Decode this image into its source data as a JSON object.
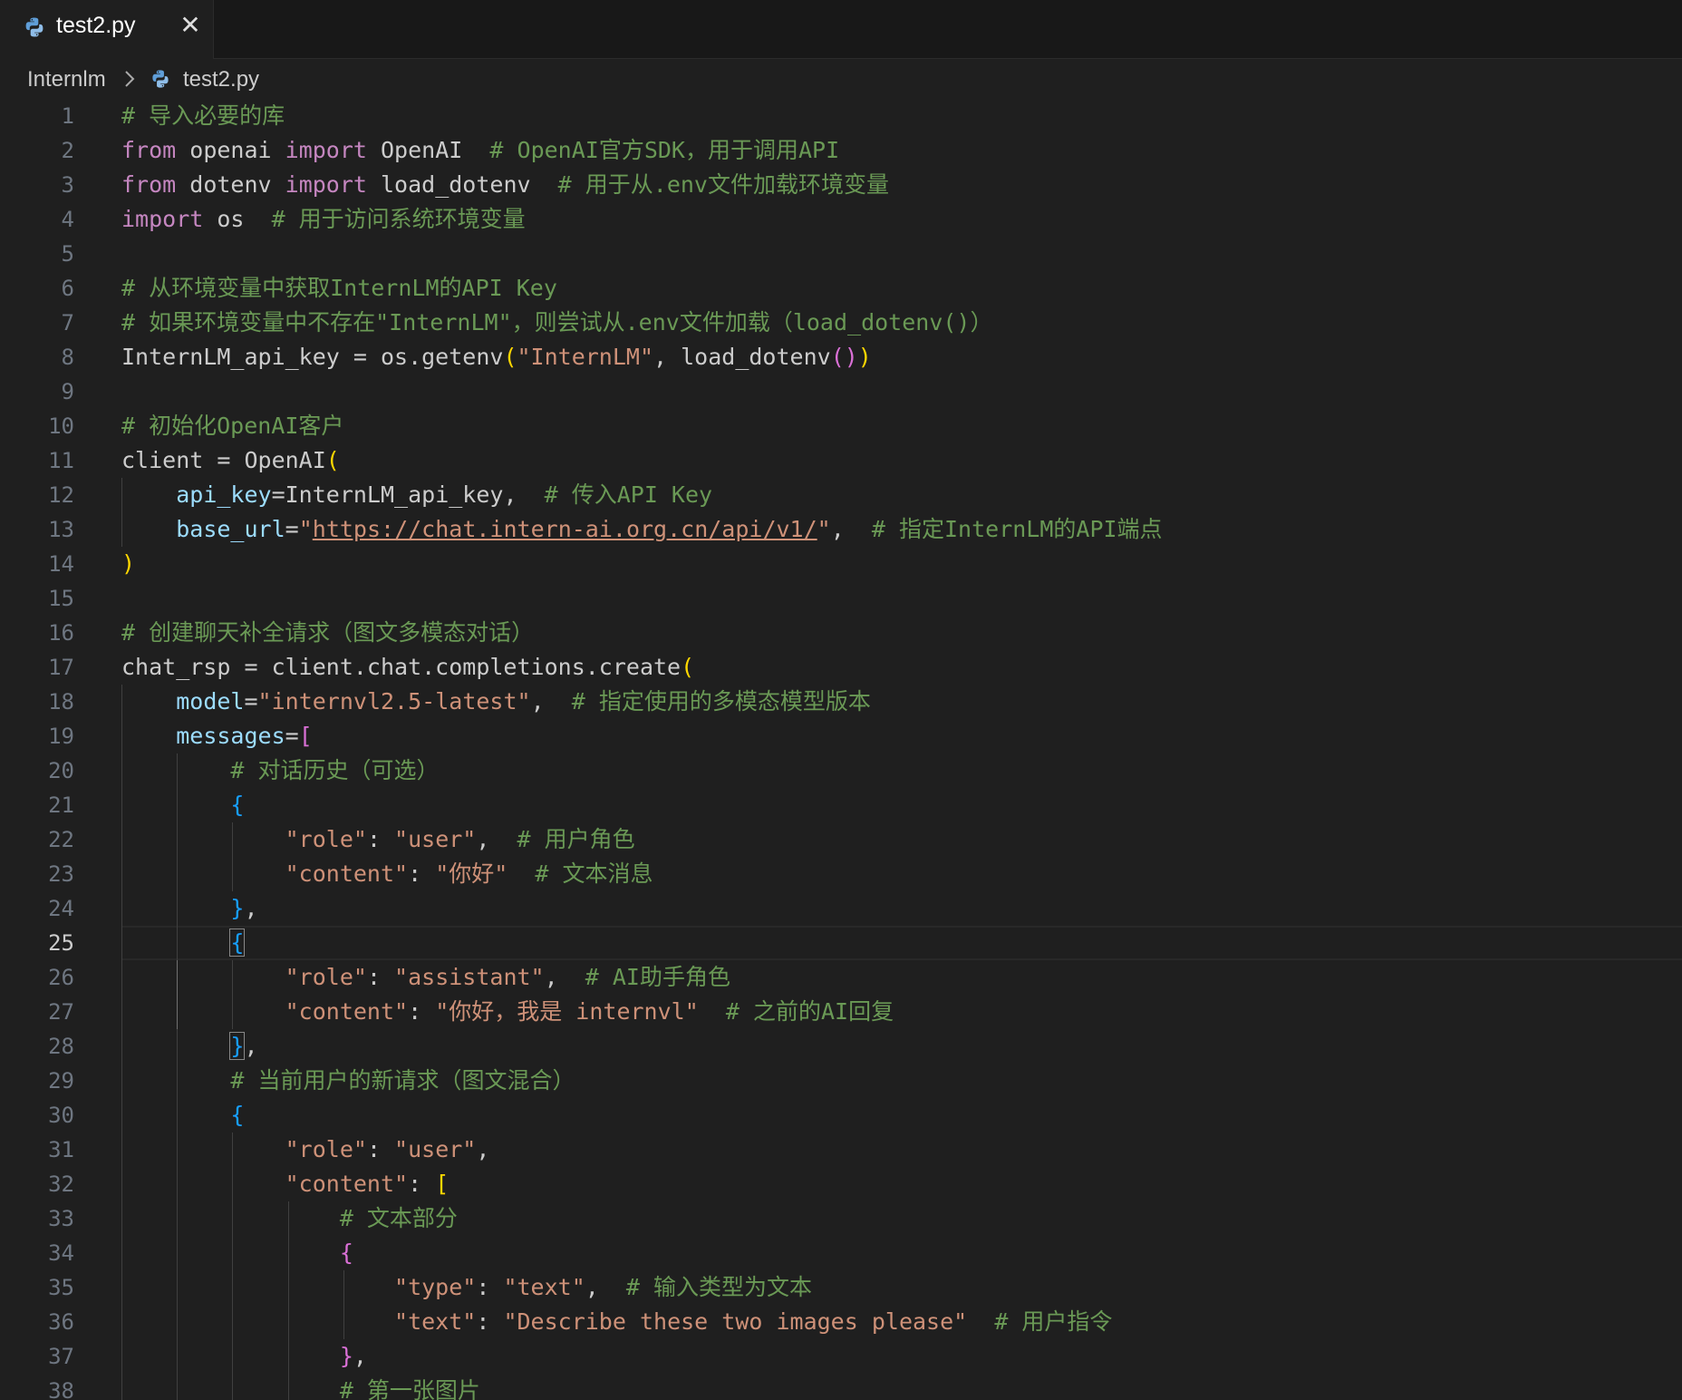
{
  "tab": {
    "label": "test2.py",
    "close_glyph": "✕",
    "icon": "python-file-icon"
  },
  "breadcrumb": {
    "folder": "Internlm",
    "file": "test2.py"
  },
  "colors": {
    "keyword": "#c586c0",
    "variable": "#9cdcfe",
    "string": "#ce9178",
    "comment": "#6a9955",
    "function": "#dcdcaa",
    "bracket_level1": "#ffd700",
    "bracket_level2": "#da70d6",
    "bracket_level3": "#179fff",
    "background": "#1f1f1f",
    "line_number": "#6e7681"
  },
  "editor": {
    "active_line": 25,
    "lines": [
      [
        [
          "cmt",
          "# 导入必要的库"
        ]
      ],
      [
        [
          "kw",
          "from"
        ],
        [
          "txt",
          " openai "
        ],
        [
          "kw",
          "import"
        ],
        [
          "txt",
          " OpenAI  "
        ],
        [
          "cmt",
          "# OpenAI官方SDK，用于调用API"
        ]
      ],
      [
        [
          "kw",
          "from"
        ],
        [
          "txt",
          " dotenv "
        ],
        [
          "kw",
          "import"
        ],
        [
          "txt",
          " load_dotenv  "
        ],
        [
          "cmt",
          "# 用于从.env文件加载环境变量"
        ]
      ],
      [
        [
          "kw",
          "import"
        ],
        [
          "txt",
          " os  "
        ],
        [
          "cmt",
          "# 用于访问系统环境变量"
        ]
      ],
      [],
      [
        [
          "cmt",
          "# 从环境变量中获取InternLM的API Key"
        ]
      ],
      [
        [
          "cmt",
          "# 如果环境变量中不存在\"InternLM\"，则尝试从.env文件加载（load_dotenv()）"
        ]
      ],
      [
        [
          "txt",
          "InternLM_api_key = os.getenv"
        ],
        [
          "b1",
          "("
        ],
        [
          "str",
          "\"InternLM\""
        ],
        [
          "txt",
          ", load_dotenv"
        ],
        [
          "b2",
          "()"
        ],
        [
          "b1",
          ")"
        ]
      ],
      [],
      [
        [
          "cmt",
          "# 初始化OpenAI客户"
        ]
      ],
      [
        [
          "txt",
          "client = OpenAI"
        ],
        [
          "b1",
          "("
        ]
      ],
      [
        [
          "txt",
          "    "
        ],
        [
          "var",
          "api_key"
        ],
        [
          "txt",
          "=InternLM_api_key,  "
        ],
        [
          "cmt",
          "# 传入API Key"
        ]
      ],
      [
        [
          "txt",
          "    "
        ],
        [
          "var",
          "base_url"
        ],
        [
          "txt",
          "="
        ],
        [
          "str",
          "\""
        ],
        [
          "link",
          "https://chat.intern-ai.org.cn/api/v1/"
        ],
        [
          "str",
          "\""
        ],
        [
          "txt",
          ",  "
        ],
        [
          "cmt",
          "# 指定InternLM的API端点"
        ]
      ],
      [
        [
          "b1",
          ")"
        ]
      ],
      [],
      [
        [
          "cmt",
          "# 创建聊天补全请求（图文多模态对话）"
        ]
      ],
      [
        [
          "txt",
          "chat_rsp = client.chat.completions.create"
        ],
        [
          "b1",
          "("
        ]
      ],
      [
        [
          "txt",
          "    "
        ],
        [
          "var",
          "model"
        ],
        [
          "txt",
          "="
        ],
        [
          "str",
          "\"internvl2.5-latest\""
        ],
        [
          "txt",
          ",  "
        ],
        [
          "cmt",
          "# 指定使用的多模态模型版本"
        ]
      ],
      [
        [
          "txt",
          "    "
        ],
        [
          "var",
          "messages"
        ],
        [
          "txt",
          "="
        ],
        [
          "b2",
          "["
        ]
      ],
      [
        [
          "txt",
          "        "
        ],
        [
          "cmt",
          "# 对话历史（可选）"
        ]
      ],
      [
        [
          "txt",
          "        "
        ],
        [
          "b3",
          "{"
        ]
      ],
      [
        [
          "txt",
          "            "
        ],
        [
          "str",
          "\"role\""
        ],
        [
          "txt",
          ": "
        ],
        [
          "str",
          "\"user\""
        ],
        [
          "txt",
          ",  "
        ],
        [
          "cmt",
          "# 用户角色"
        ]
      ],
      [
        [
          "txt",
          "            "
        ],
        [
          "str",
          "\"content\""
        ],
        [
          "txt",
          ": "
        ],
        [
          "str",
          "\"你好\""
        ],
        [
          "txt",
          "  "
        ],
        [
          "cmt",
          "# 文本消息"
        ]
      ],
      [
        [
          "txt",
          "        "
        ],
        [
          "b3",
          "}"
        ],
        [
          "txt",
          ","
        ]
      ],
      [
        [
          "txt",
          "        "
        ],
        [
          "b3m",
          "{"
        ]
      ],
      [
        [
          "txt",
          "            "
        ],
        [
          "str",
          "\"role\""
        ],
        [
          "txt",
          ": "
        ],
        [
          "str",
          "\"assistant\""
        ],
        [
          "txt",
          ",  "
        ],
        [
          "cmt",
          "# AI助手角色"
        ]
      ],
      [
        [
          "txt",
          "            "
        ],
        [
          "str",
          "\"content\""
        ],
        [
          "txt",
          ": "
        ],
        [
          "str",
          "\"你好，我是 internvl\""
        ],
        [
          "txt",
          "  "
        ],
        [
          "cmt",
          "# 之前的AI回复"
        ]
      ],
      [
        [
          "txt",
          "        "
        ],
        [
          "b3m",
          "}"
        ],
        [
          "txt",
          ","
        ]
      ],
      [
        [
          "txt",
          "        "
        ],
        [
          "cmt",
          "# 当前用户的新请求（图文混合）"
        ]
      ],
      [
        [
          "txt",
          "        "
        ],
        [
          "b3",
          "{"
        ]
      ],
      [
        [
          "txt",
          "            "
        ],
        [
          "str",
          "\"role\""
        ],
        [
          "txt",
          ": "
        ],
        [
          "str",
          "\"user\""
        ],
        [
          "txt",
          ","
        ]
      ],
      [
        [
          "txt",
          "            "
        ],
        [
          "str",
          "\"content\""
        ],
        [
          "txt",
          ": "
        ],
        [
          "b1",
          "["
        ]
      ],
      [
        [
          "txt",
          "                "
        ],
        [
          "cmt",
          "# 文本部分"
        ]
      ],
      [
        [
          "txt",
          "                "
        ],
        [
          "b2",
          "{"
        ]
      ],
      [
        [
          "txt",
          "                    "
        ],
        [
          "str",
          "\"type\""
        ],
        [
          "txt",
          ": "
        ],
        [
          "str",
          "\"text\""
        ],
        [
          "txt",
          ",  "
        ],
        [
          "cmt",
          "# 输入类型为文本"
        ]
      ],
      [
        [
          "txt",
          "                    "
        ],
        [
          "str",
          "\"text\""
        ],
        [
          "txt",
          ": "
        ],
        [
          "str",
          "\"Describe these two images please\""
        ],
        [
          "txt",
          "  "
        ],
        [
          "cmt",
          "# 用户指令"
        ]
      ],
      [
        [
          "txt",
          "                "
        ],
        [
          "b2",
          "}"
        ],
        [
          "txt",
          ","
        ]
      ],
      [
        [
          "txt",
          "                "
        ],
        [
          "cmt",
          "# 第一张图片"
        ]
      ]
    ]
  }
}
